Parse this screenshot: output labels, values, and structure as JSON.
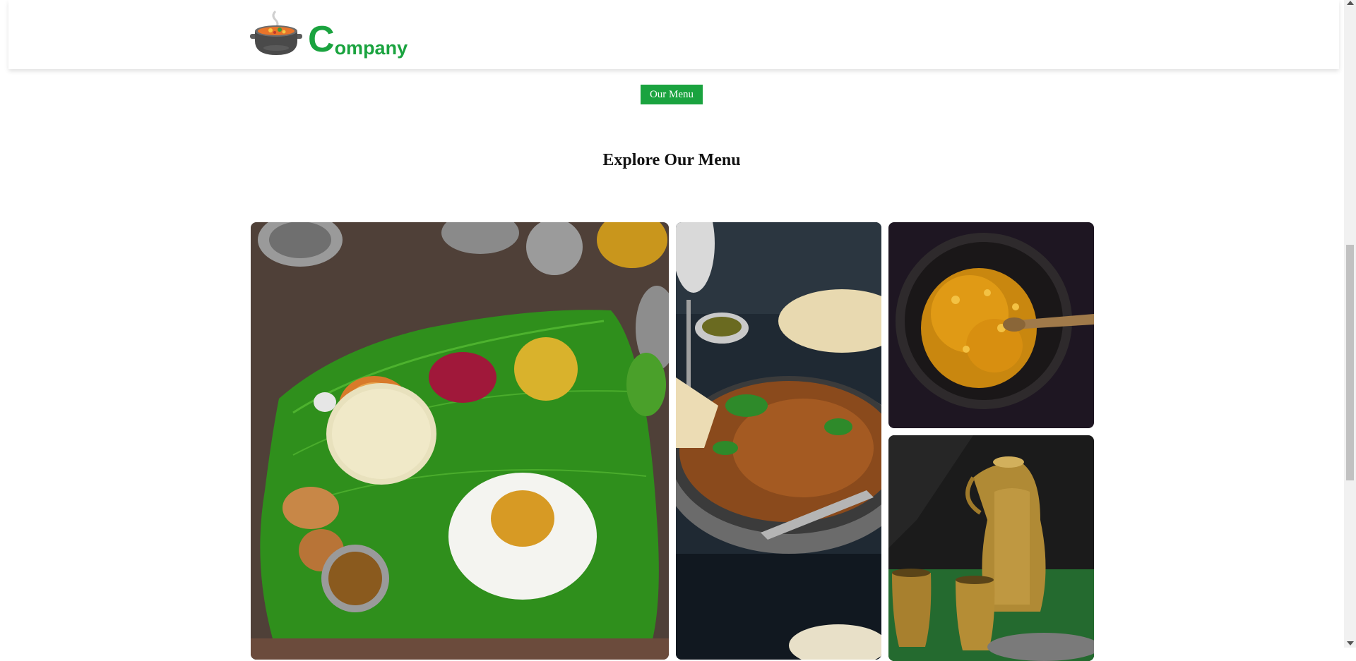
{
  "brand": {
    "logo_letter": "C",
    "logo_rest": "ompany",
    "logo_icon": "cooking-pot-icon",
    "color": "#1aa33f"
  },
  "nav": {
    "menu_button_label": "Our Menu"
  },
  "section": {
    "title": "Explore Our Menu"
  },
  "gallery": [
    {
      "name": "banana-leaf-thali"
    },
    {
      "name": "mutton-curry-pan"
    },
    {
      "name": "pumpkin-stir-fry"
    },
    {
      "name": "brass-jug-and-cups"
    }
  ]
}
